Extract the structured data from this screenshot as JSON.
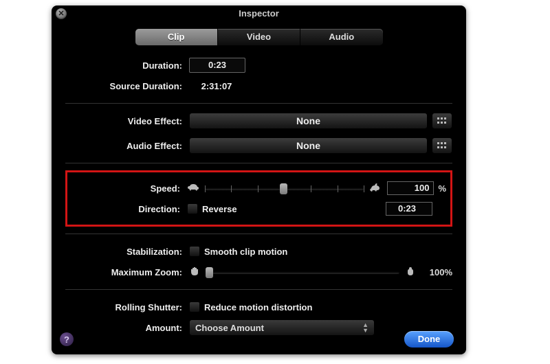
{
  "window": {
    "title": "Inspector"
  },
  "tabs": {
    "items": [
      "Clip",
      "Video",
      "Audio"
    ],
    "active": "Clip"
  },
  "duration": {
    "label": "Duration:",
    "value": "0:23"
  },
  "sourceDuration": {
    "label": "Source Duration:",
    "value": "2:31:07"
  },
  "videoEffect": {
    "label": "Video Effect:",
    "value": "None"
  },
  "audioEffect": {
    "label": "Audio Effect:",
    "value": "None"
  },
  "speed": {
    "label": "Speed:",
    "value": "100",
    "percent": "%",
    "sliderPos": 47
  },
  "direction": {
    "label": "Direction:",
    "checkboxLabel": "Reverse",
    "timeValue": "0:23"
  },
  "stabilization": {
    "label": "Stabilization:",
    "checkboxLabel": "Smooth clip motion"
  },
  "maxZoom": {
    "label": "Maximum Zoom:",
    "value": "100%",
    "sliderPos": 0
  },
  "rollingShutter": {
    "label": "Rolling Shutter:",
    "checkboxLabel": "Reduce motion distortion"
  },
  "amount": {
    "label": "Amount:",
    "value": "Choose Amount"
  },
  "footer": {
    "done": "Done",
    "help": "?"
  },
  "icons": {
    "close": "✕"
  }
}
